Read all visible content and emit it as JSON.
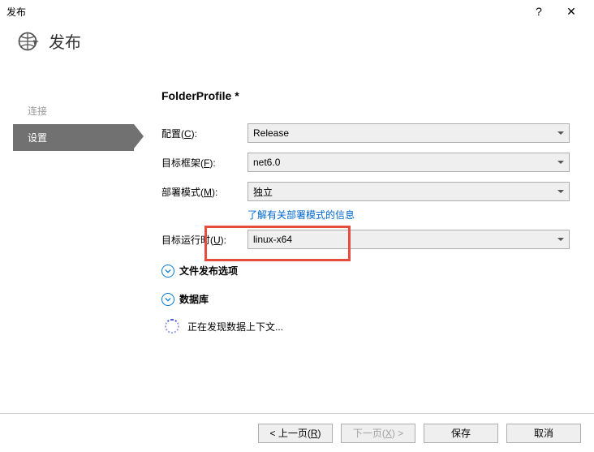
{
  "titlebar": {
    "title": "发布",
    "help": "?",
    "close": "✕"
  },
  "header": {
    "title": "发布"
  },
  "sidebar": {
    "items": [
      {
        "label": "连接"
      },
      {
        "label": "设置"
      }
    ]
  },
  "main": {
    "profile_title": "FolderProfile *",
    "rows": {
      "config": {
        "label": "配置(C):",
        "value": "Release"
      },
      "framework": {
        "label": "目标框架(F):",
        "value": "net6.0"
      },
      "deploy": {
        "label": "部署模式(M):",
        "value": "独立"
      },
      "deploy_link": "了解有关部署模式的信息",
      "runtime": {
        "label": "目标运行时(U):",
        "value": "linux-x64"
      }
    },
    "expanders": {
      "file_publish": "文件发布选项",
      "database": "数据库"
    },
    "loading": "正在发现数据上下文..."
  },
  "footer": {
    "prev": "< 上一页(R)",
    "next": "下一页(X) >",
    "save": "保存",
    "cancel": "取消"
  }
}
